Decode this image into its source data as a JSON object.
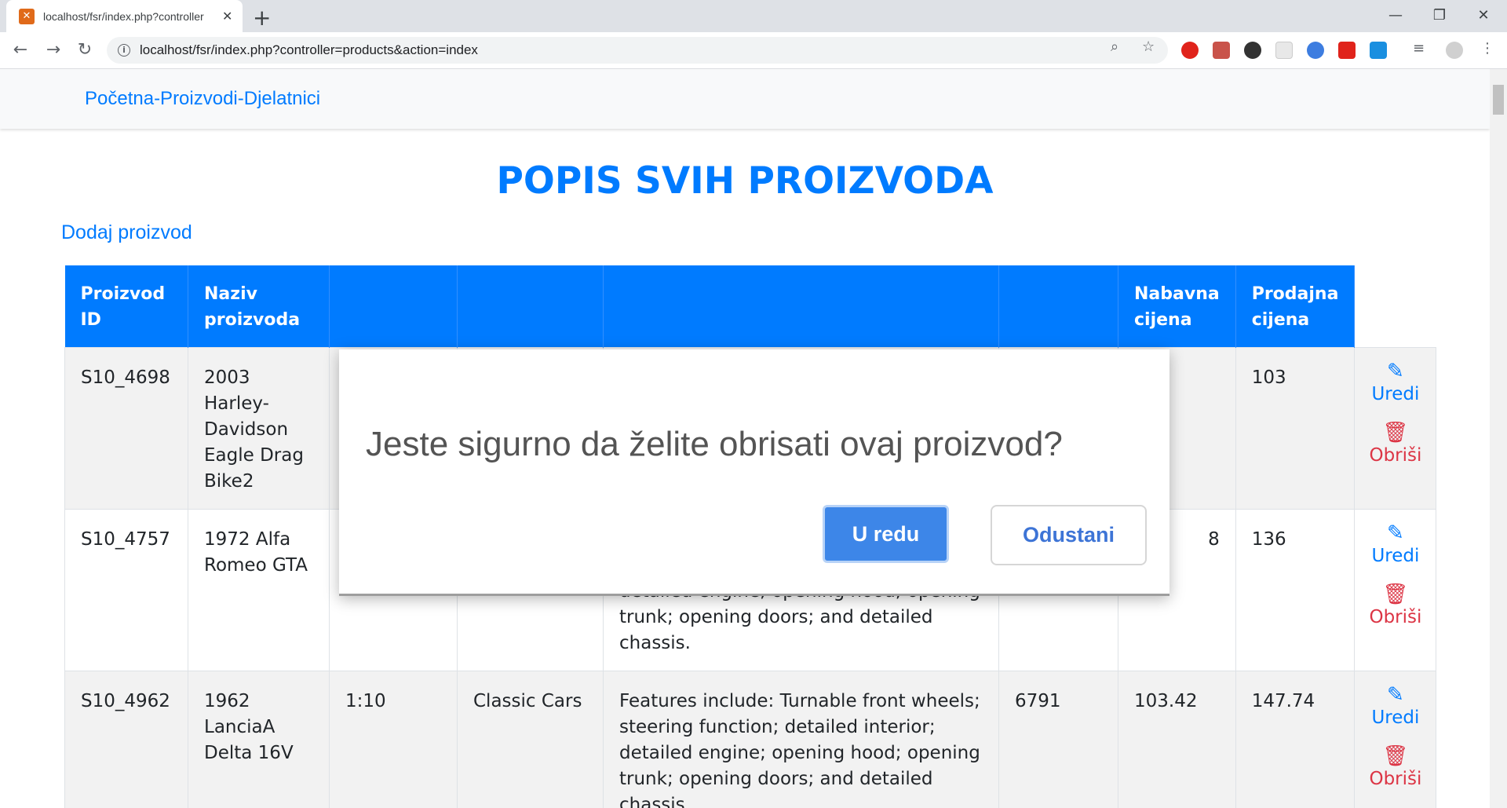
{
  "browser": {
    "tab_title": "localhost/fsr/index.php?controller",
    "tab_close": "✕",
    "new_tab": "+",
    "url": "localhost/fsr/index.php?controller=products&action=index",
    "window_controls": {
      "minimize": "—",
      "restore": "❐",
      "close": "✕"
    }
  },
  "navbar": {
    "brand": "Početna-Proizvodi-Djelatnici"
  },
  "main": {
    "title": "POPIS SVIH PROIZVODA",
    "add_link": "Dodaj proizvod"
  },
  "table": {
    "headers": [
      "Proizvod ID",
      "Naziv proizvoda",
      "",
      "",
      "",
      "",
      "Nabavna cijena",
      "Prodajna cijena"
    ],
    "rows": [
      {
        "id": "S10_4698",
        "name": "2003 Harley-Davidson Eagle Drag Bike2",
        "scale": "",
        "line": "",
        "description": "",
        "stock": "",
        "buy": "",
        "sell": "103",
        "edit": "Uredi",
        "delete": "Obriši"
      },
      {
        "id": "S10_4757",
        "name": "1972 Alfa Romeo GTA",
        "scale": "",
        "line": "",
        "description": "steering function; detailed interior; detailed engine; opening hood; opening trunk; opening doors; and detailed chassis.",
        "stock": "",
        "buy": "8",
        "sell": "136",
        "edit": "Uredi",
        "delete": "Obriši"
      },
      {
        "id": "S10_4962",
        "name": "1962 LanciaA Delta 16V",
        "scale": "1:10",
        "line": "Classic Cars",
        "description": "Features include: Turnable front wheels; steering function; detailed interior; detailed engine; opening hood; opening trunk; opening doors; and detailed chassis.",
        "stock": "6791",
        "buy": "103.42",
        "sell": "147.74",
        "edit": "Uredi",
        "delete": "Obriši"
      }
    ]
  },
  "modal": {
    "message": "Jeste sigurno da želite obrisati ovaj proizvod?",
    "ok_label": "U redu",
    "cancel_label": "Odustani"
  },
  "colors": {
    "primary": "#007bff",
    "danger": "#dc3545",
    "modal_ok": "#3d86e8"
  },
  "icons": {
    "edit": "edit-icon",
    "delete": "trash-icon"
  }
}
